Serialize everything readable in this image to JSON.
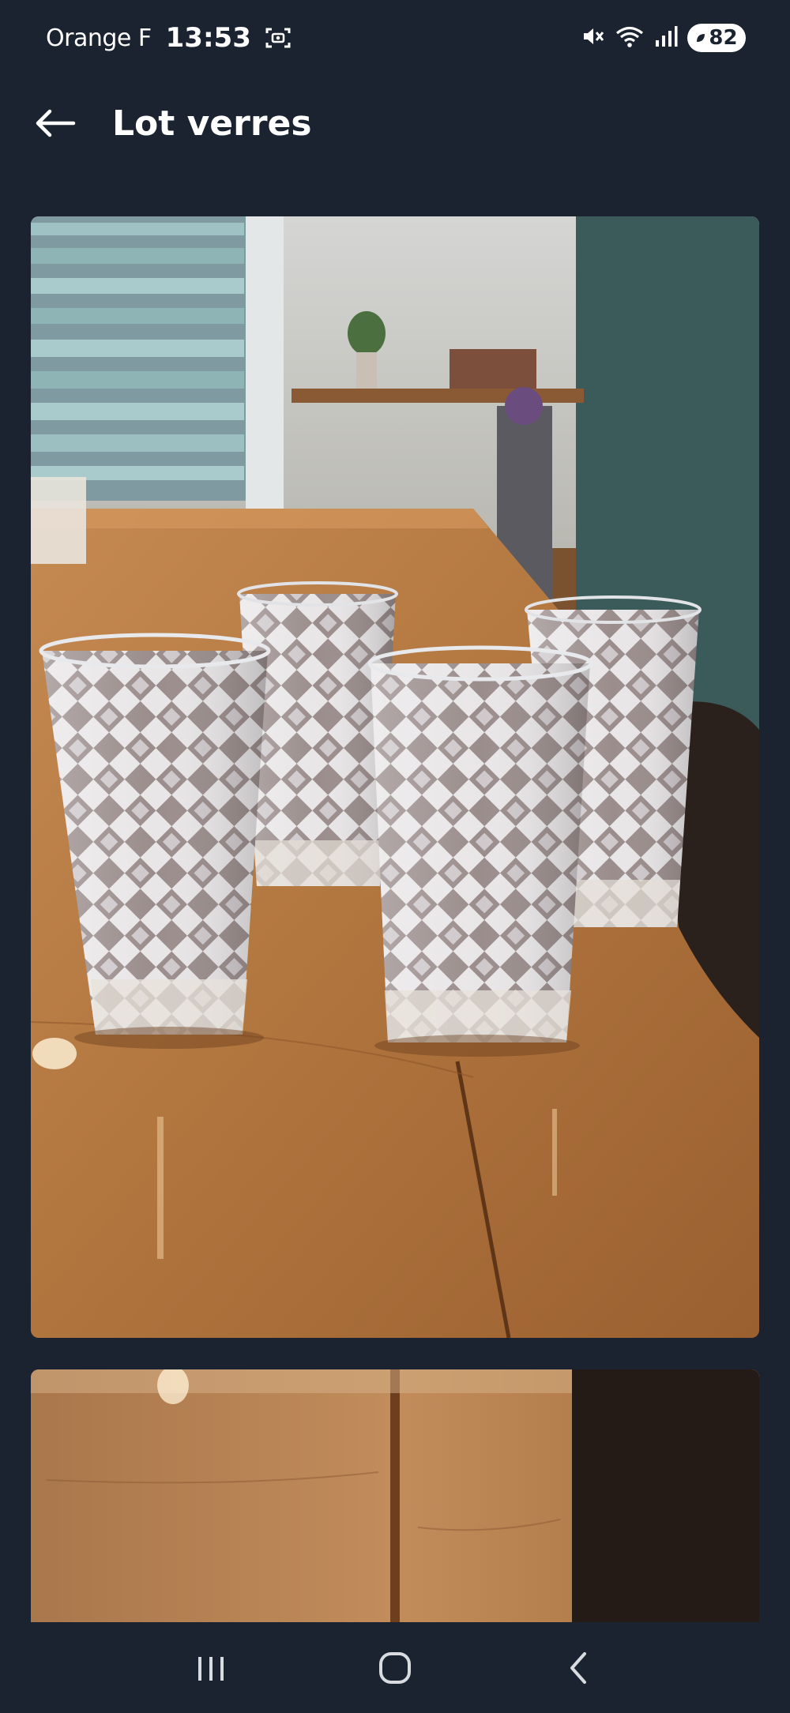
{
  "status_bar": {
    "carrier": "Orange F",
    "time": "13:53",
    "battery": "82"
  },
  "header": {
    "title": "Lot verres"
  },
  "icons": {
    "back": "arrow-left-icon",
    "screenshot": "screenshot-icon",
    "mute": "mute-icon",
    "wifi": "wifi-icon",
    "signal": "signal-icon",
    "recent_apps": "recent-apps-icon",
    "home": "home-icon",
    "nav_back": "chevron-left-icon"
  },
  "colors": {
    "background": "#1b2330",
    "text": "#ffffff",
    "table_wood": "#b77a44"
  },
  "gallery": {
    "photo_count": 2
  }
}
